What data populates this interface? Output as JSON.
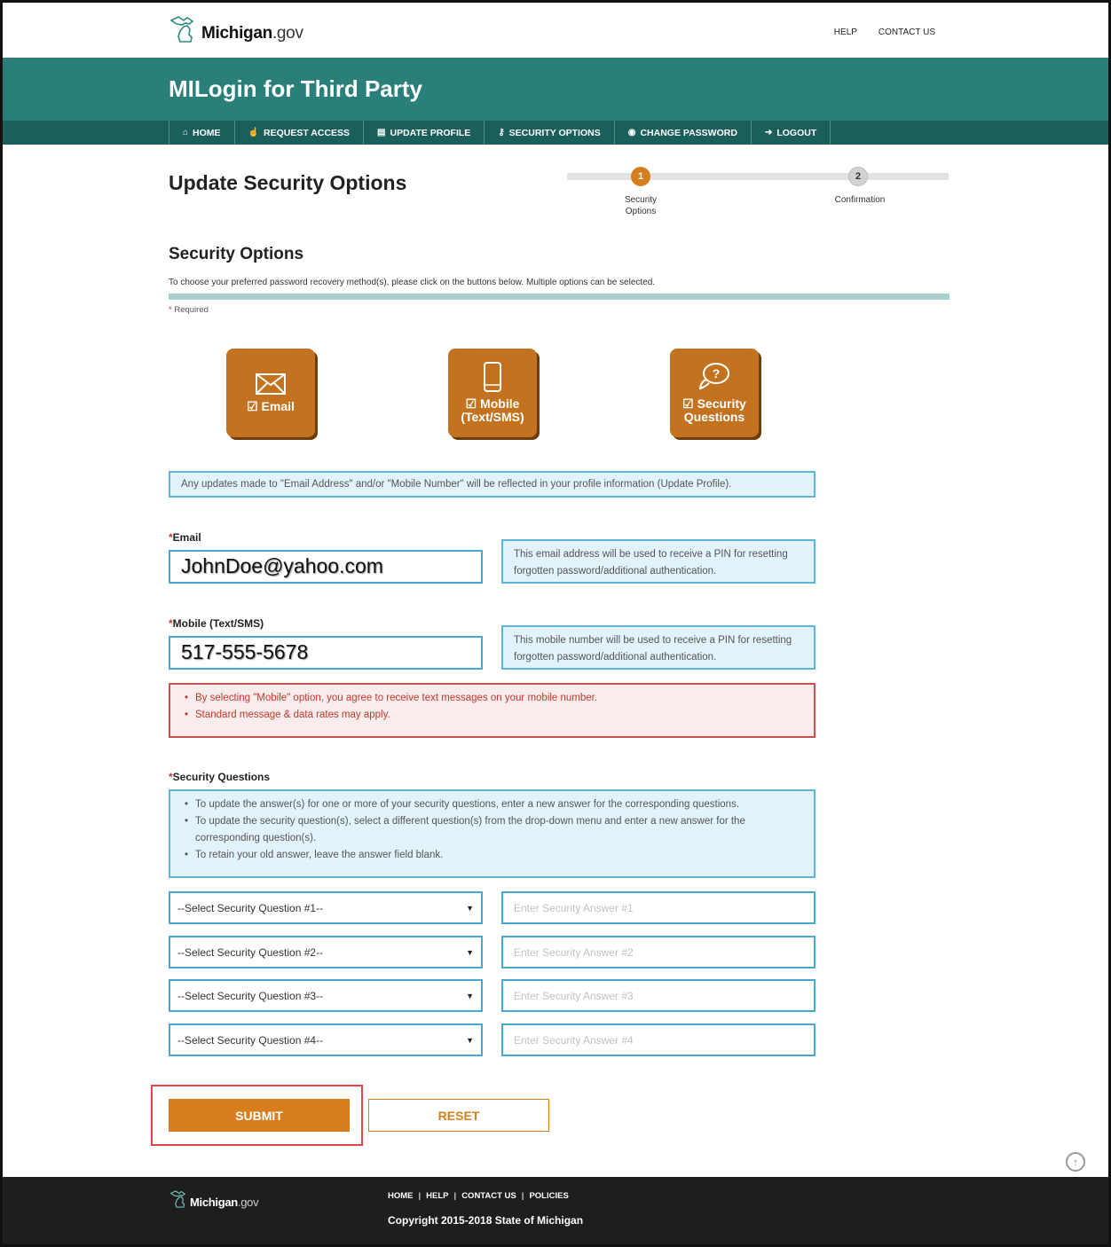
{
  "header": {
    "logo_main": "Michigan",
    "logo_suffix": ".gov",
    "links": [
      "HELP",
      "CONTACT US"
    ]
  },
  "band": {
    "title": "MILogin for Third Party"
  },
  "nav": {
    "items": [
      {
        "label": "HOME",
        "icon": "home-icon"
      },
      {
        "label": "REQUEST ACCESS",
        "icon": "hand-pointer-icon"
      },
      {
        "label": "UPDATE PROFILE",
        "icon": "id-card-icon"
      },
      {
        "label": "SECURITY OPTIONS",
        "icon": "key-icon"
      },
      {
        "label": "CHANGE PASSWORD",
        "icon": "lock-icon"
      },
      {
        "label": "LOGOUT",
        "icon": "sign-out-icon"
      }
    ]
  },
  "page": {
    "title": "Update Security Options",
    "steps": [
      {
        "num": "1",
        "label": "Security Options",
        "active": true
      },
      {
        "num": "2",
        "label": "Confirmation",
        "active": false
      }
    ],
    "section_title": "Security Options",
    "intro": "To choose your preferred password recovery method(s), please click on the buttons below. Multiple options can be selected.",
    "required": "Required"
  },
  "options": [
    {
      "label": "Email",
      "icon": "envelope-icon",
      "checked": true
    },
    {
      "label_line1": "Mobile",
      "label_line2": "(Text/SMS)",
      "icon": "mobile-phone-icon",
      "checked": true
    },
    {
      "label_line1": "Security",
      "label_line2": "Questions",
      "icon": "question-bubble-icon",
      "checked": true
    }
  ],
  "profile_note": "Any updates made to \"Email Address\" and/or \"Mobile Number\" will be reflected in your profile information (Update Profile).",
  "email": {
    "label": "Email",
    "value": "JohnDoe@yahoo.com",
    "help": "This email address will be used to receive a PIN for resetting forgotten password/additional authentication."
  },
  "mobile": {
    "label": "Mobile (Text/SMS)",
    "value": "517-555-5678",
    "help": "This mobile number will be used to receive a PIN for resetting forgotten password/additional authentication.",
    "warnings": [
      "By selecting \"Mobile\" option, you agree to receive text messages on your mobile number.",
      "Standard message & data rates may apply."
    ]
  },
  "questions": {
    "label": "Security Questions",
    "notes": [
      "To update the answer(s) for one or more of your security questions, enter a new answer for the corresponding questions.",
      "To update the security question(s), select a different question(s) from the drop-down menu and enter a new answer for the corresponding question(s).",
      "To retain your old answer, leave the answer field blank."
    ],
    "rows": [
      {
        "select": "--Select Security Question #1--",
        "answer_placeholder": "Enter Security Answer #1"
      },
      {
        "select": "--Select Security Question #2--",
        "answer_placeholder": "Enter Security Answer #2"
      },
      {
        "select": "--Select Security Question #3--",
        "answer_placeholder": "Enter Security Answer #3"
      },
      {
        "select": "--Select Security Question #4--",
        "answer_placeholder": "Enter Security Answer #4"
      }
    ]
  },
  "buttons": {
    "submit": "SUBMIT",
    "reset": "RESET"
  },
  "footer": {
    "logo_main": "Michigan",
    "logo_suffix": ".gov",
    "links": [
      "HOME",
      "HELP",
      "CONTACT US",
      "POLICIES"
    ],
    "copyright": "Copyright 2015-2018 State of Michigan"
  },
  "colors": {
    "band": "#2a7f78",
    "nav": "#1b5f5a",
    "accent": "#d67e1e",
    "tile": "#c3731f",
    "info_border": "#5bb6dc",
    "warn_border": "#c85050"
  }
}
